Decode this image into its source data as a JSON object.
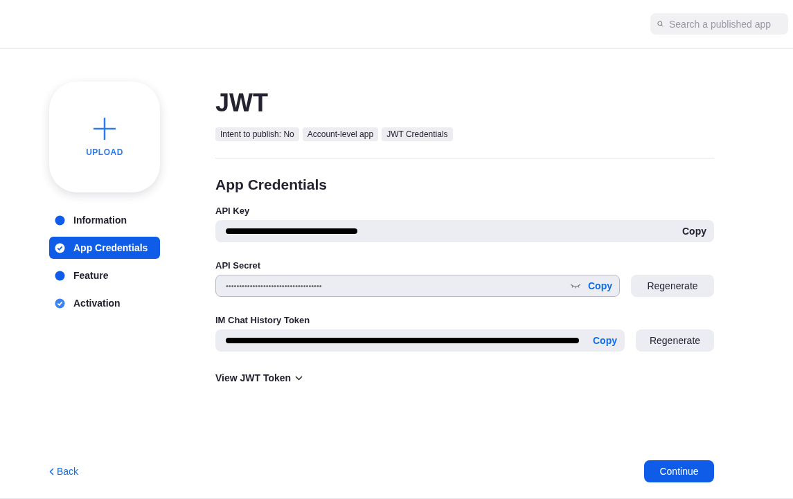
{
  "search": {
    "placeholder": "Search a published app"
  },
  "upload": {
    "label": "UPLOAD"
  },
  "steps": [
    {
      "label": "Information",
      "selected": false,
      "checked": false
    },
    {
      "label": "App Credentials",
      "selected": true,
      "checked": true
    },
    {
      "label": "Feature",
      "selected": false,
      "checked": false
    },
    {
      "label": "Activation",
      "selected": false,
      "checked": true
    }
  ],
  "title": "JWT",
  "tags": [
    "Intent to publish: No",
    "Account-level app",
    "JWT Credentials"
  ],
  "section_title": "App Credentials",
  "fields": [
    {
      "label": "API Key",
      "kind": "plain",
      "redacted": true,
      "copy": {
        "label": "Copy",
        "kind": "dark"
      }
    },
    {
      "label": "API Secret",
      "kind": "secret",
      "value": "••••••••••••••••••••••••••••••••••••",
      "copy": {
        "label": "Copy",
        "kind": "link"
      },
      "regenerate": "Regenerate"
    },
    {
      "label": "IM Chat History Token",
      "kind": "plain",
      "redacted": true,
      "copy": {
        "label": "Copy",
        "kind": "link"
      },
      "regenerate": "Regenerate"
    }
  ],
  "view_token": "View JWT Token",
  "back": "Back",
  "continue": "Continue"
}
